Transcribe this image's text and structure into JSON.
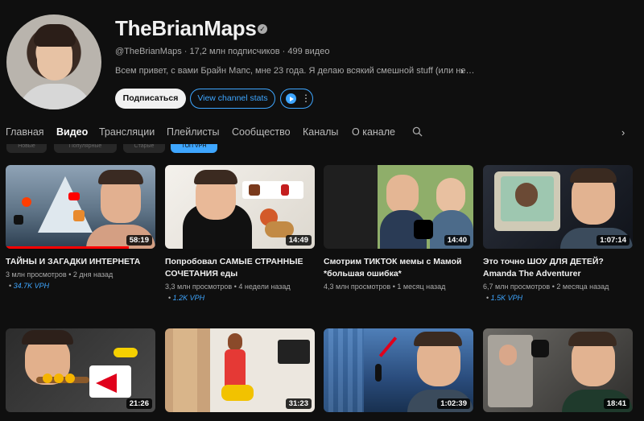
{
  "channel": {
    "name": "TheBrianMaps",
    "handle": "@TheBrianMaps",
    "subscribers": "17,2 млн подписчиков",
    "videos_count": "499 видео",
    "description": "Всем привет, с вами Брайн Мапс, мне 23 года. Я делаю всякий смешной stuff (или не…",
    "subscribe_label": "Подписаться",
    "stats_label": "View channel stats"
  },
  "tabs": [
    {
      "label": "Главная"
    },
    {
      "label": "Видео"
    },
    {
      "label": "Трансляции"
    },
    {
      "label": "Плейлисты"
    },
    {
      "label": "Сообщество"
    },
    {
      "label": "Каналы"
    },
    {
      "label": "О канале"
    }
  ],
  "chips": [
    {
      "label": "Новые"
    },
    {
      "label": "Популярные"
    },
    {
      "label": "Старые"
    },
    {
      "label": "ТОП VPH"
    }
  ],
  "videos": [
    {
      "title": "ТАЙНЫ И ЗАГАДКИ ИНТЕРНЕТА",
      "views": "3 млн просмотров",
      "age": "2 дня назад",
      "vph": "34.7K VPH",
      "duration": "58:19",
      "progress": 0.82
    },
    {
      "title": "Попробовал САМЫЕ СТРАННЫЕ СОЧЕТАНИЯ еды",
      "views": "3,3 млн просмотров",
      "age": "4 недели назад",
      "vph": "1.2K VPH",
      "duration": "14:49",
      "progress": 0
    },
    {
      "title": "Смотрим ТИКТОК мемы с Мамой *большая ошибка*",
      "views": "4,3 млн просмотров",
      "age": "1 месяц назад",
      "vph": "",
      "duration": "14:40",
      "progress": 0
    },
    {
      "title": "Это точно ШОУ ДЛЯ ДЕТЕЙ? Amanda The Adventurer",
      "views": "6,7 млн просмотров",
      "age": "2 месяца назад",
      "vph": "1.5K VPH",
      "duration": "1:07:14",
      "progress": 0
    },
    {
      "title": "",
      "views": "",
      "age": "",
      "vph": "",
      "duration": "21:26",
      "progress": 0
    },
    {
      "title": "",
      "views": "",
      "age": "",
      "vph": "",
      "duration": "31:23",
      "progress": 0
    },
    {
      "title": "",
      "views": "",
      "age": "",
      "vph": "",
      "duration": "1:02:39",
      "progress": 0
    },
    {
      "title": "",
      "views": "",
      "age": "",
      "vph": "",
      "duration": "18:41",
      "progress": 0
    }
  ],
  "icons": {
    "search": "search-icon",
    "more": "more-dots-icon",
    "next": "chevron-right-icon",
    "verified": "verified-check-icon"
  },
  "colors": {
    "background": "#0f0f0f",
    "accent": "#3ea6ff",
    "progress": "#ff0000"
  }
}
